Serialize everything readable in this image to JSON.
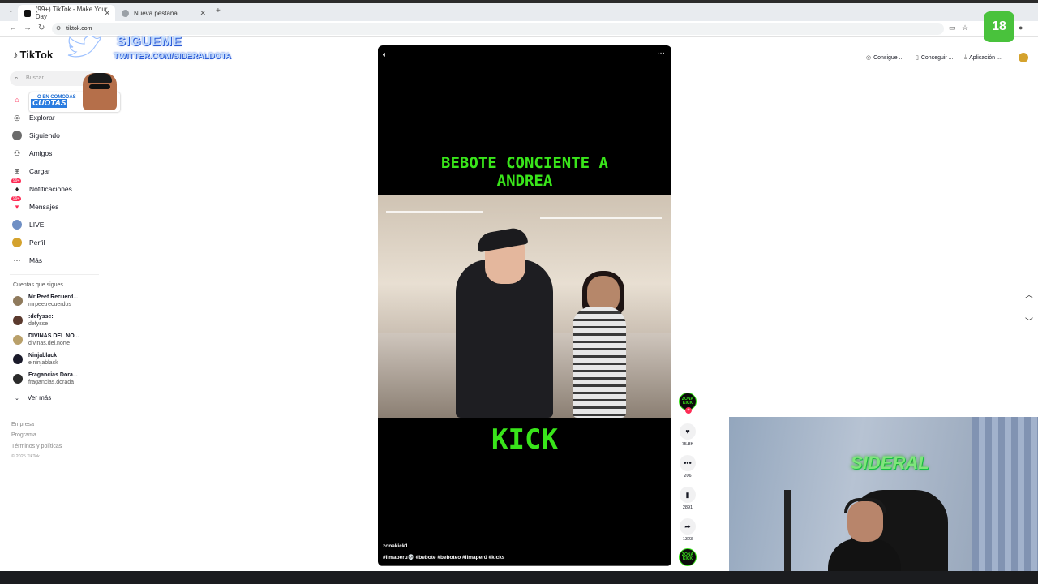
{
  "browser": {
    "tabs": [
      {
        "label": "(99+) TikTok - Make Your Day",
        "active": true
      },
      {
        "label": "Nueva pestaña",
        "active": false
      }
    ],
    "url": "tiktok.com"
  },
  "sidebar": {
    "logo": "TikTok",
    "search_placeholder": "Buscar",
    "nav": [
      {
        "label": "",
        "icon": "home-icon"
      },
      {
        "label": "Explorar",
        "icon": "compass-icon"
      },
      {
        "label": "Siguiendo",
        "icon": "following-icon"
      },
      {
        "label": "Amigos",
        "icon": "friends-icon"
      },
      {
        "label": "Cargar",
        "icon": "upload-icon"
      },
      {
        "label": "Notificaciones",
        "icon": "bell-icon",
        "badge": "99+"
      },
      {
        "label": "Mensajes",
        "icon": "message-icon",
        "badge": "99+"
      },
      {
        "label": "LIVE",
        "icon": "live-icon"
      },
      {
        "label": "Perfil",
        "icon": "profile-icon"
      },
      {
        "label": "Más",
        "icon": "more-icon"
      }
    ],
    "following_title": "Cuentas que sigues",
    "accounts": [
      {
        "name": "Mr Peet Recuerd...",
        "handle": "mrpeetrecuerdos",
        "color": "#8f7a5c"
      },
      {
        "name": ":defysse:",
        "handle": "defysse",
        "color": "#5b3a2e"
      },
      {
        "name": "DIVINAS DEL NO...",
        "handle": "divinas.del.norte",
        "color": "#b9a06a"
      },
      {
        "name": "Ninjablack",
        "handle": "elninjablack",
        "color": "#1a1a2a"
      },
      {
        "name": "Fragancias Dora...",
        "handle": "fragancias.dorada",
        "color": "#2b2b2b"
      }
    ],
    "see_more": "Ver más",
    "footer": [
      "Empresa",
      "Programa",
      "Términos y políticas"
    ],
    "copyright": "© 2025 TikTok"
  },
  "overlay": {
    "sigueme": "SIGUEME",
    "twitter": "TWITTER.COM/SIDERALDOTA",
    "promo_line1": "O EN COMODAS",
    "promo_line2": "CUOTAS"
  },
  "video": {
    "caption_top": "BEBOTE CONCIENTE A ANDREA",
    "caption_bottom": "KICK",
    "author": "zonakick1",
    "tags": "#limaperu💀 #bebote #beboteo #limaperú #kicks",
    "progress": 0.0
  },
  "actions": {
    "creator_badge": "ZONA KICK",
    "likes": "75.8K",
    "comments": "206",
    "saves": "2891",
    "shares": "1323"
  },
  "top_links": [
    {
      "label": "Consigue ...",
      "icon": "coin-icon"
    },
    {
      "label": "Conseguir ...",
      "icon": "phone-icon"
    },
    {
      "label": "Aplicación ...",
      "icon": "download-icon"
    }
  ],
  "age_badge": "18",
  "webcam": {
    "logo": "SIDERAL"
  }
}
